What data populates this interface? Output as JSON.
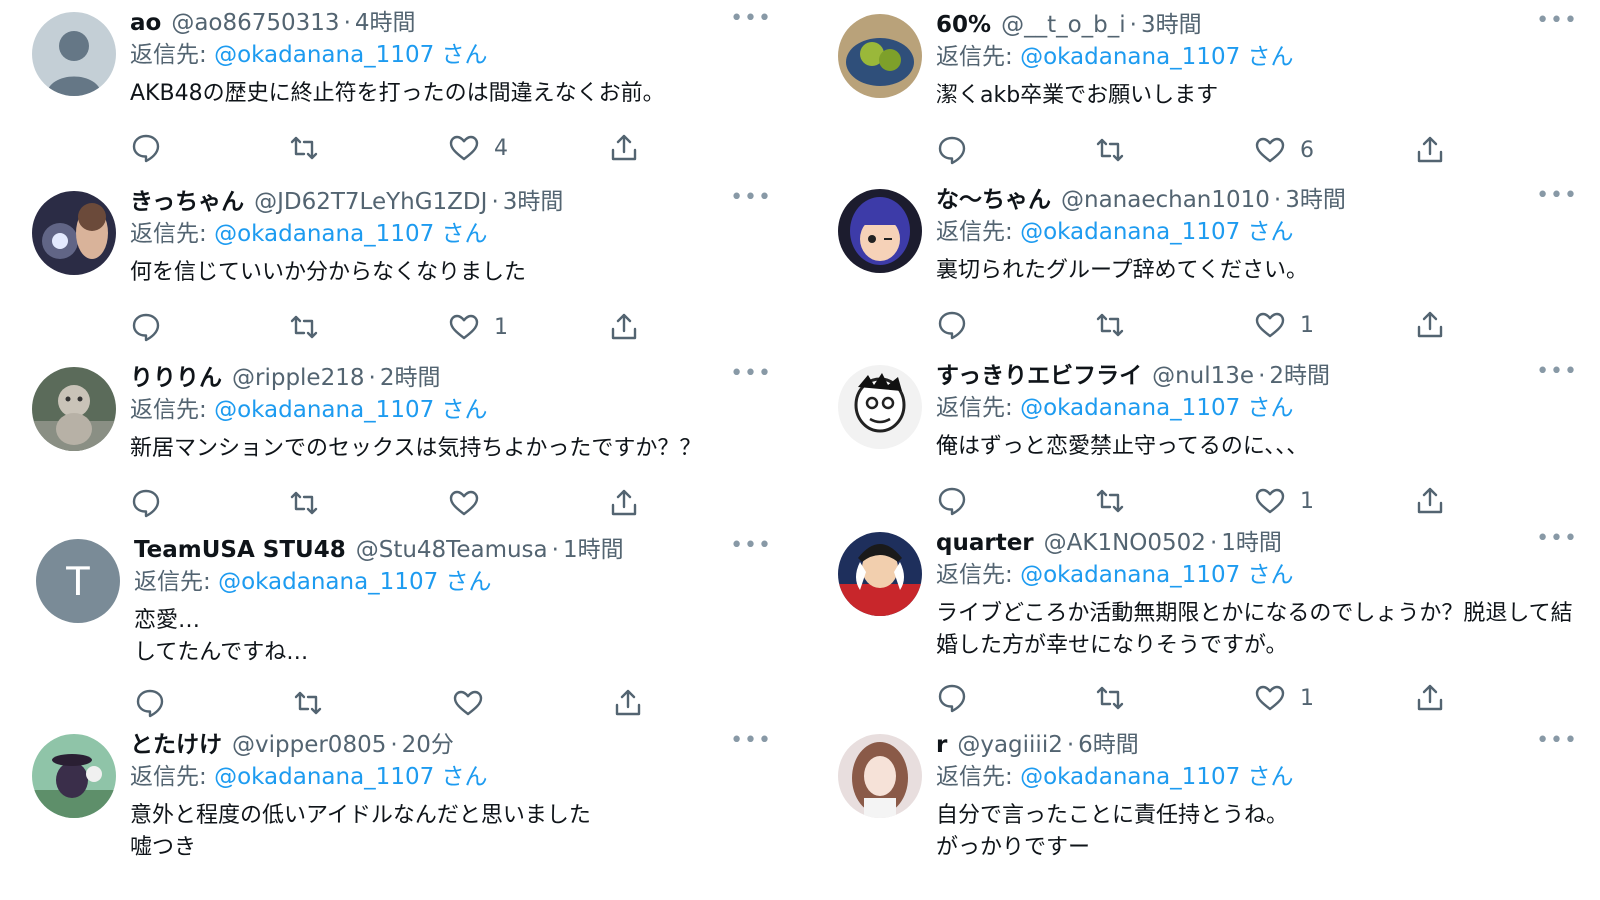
{
  "left": [
    {
      "name": "ao",
      "handle": "@ao86750313",
      "time": "4時間",
      "reply_prefix": "返信先:",
      "reply_to": "@okadanana_1107 さん",
      "text": "AKB48の歴史に終止符を打ったのは間違えなくお前。",
      "likes": "4",
      "avatar": "default-avatar-icon"
    },
    {
      "name": "きっちゃん",
      "handle": "@JD62T7LeYhG1ZDJ",
      "time": "3時間",
      "reply_prefix": "返信先:",
      "reply_to": "@okadanana_1107 さん",
      "text": "何を信じていいか分からなくなりました",
      "likes": "1",
      "avatar": "photo-avatar"
    },
    {
      "name": "りりりん",
      "handle": "@ripple218",
      "time": "2時間",
      "reply_prefix": "返信先:",
      "reply_to": "@okadanana_1107 さん",
      "text": "新居マンションでのセックスは気持ちよかったですか？？",
      "likes": "",
      "avatar": "photo-avatar"
    },
    {
      "name": "TeamUSA STU48",
      "handle": "@Stu48Teamusa",
      "time": "1時間",
      "reply_prefix": "返信先:",
      "reply_to": "@okadanana_1107 さん",
      "text": "恋愛…\nしてたんですね…",
      "likes": "",
      "avatar": "letter-avatar",
      "avatar_letter": "T"
    },
    {
      "name": "とたけけ",
      "handle": "@vipper0805",
      "time": "20分",
      "reply_prefix": "返信先:",
      "reply_to": "@okadanana_1107 さん",
      "text": "意外と程度の低いアイドルなんだと思いました\n嘘つき",
      "likes": "",
      "avatar": "photo-avatar"
    }
  ],
  "right": [
    {
      "name": "60%",
      "handle": "@__t_o_b_i",
      "time": "3時間",
      "reply_prefix": "返信先:",
      "reply_to": "@okadanana_1107 さん",
      "text": "潔くakb卒業でお願いします",
      "likes": "6",
      "avatar": "photo-avatar"
    },
    {
      "name": "な〜ちゃん",
      "handle": "@nanaechan1010",
      "time": "3時間",
      "reply_prefix": "返信先:",
      "reply_to": "@okadanana_1107 さん",
      "text": "裏切られたグループ辞めてください。",
      "likes": "1",
      "avatar": "photo-avatar"
    },
    {
      "name": "すっきりエビフライ",
      "handle": "@nul13e",
      "time": "2時間",
      "reply_prefix": "返信先:",
      "reply_to": "@okadanana_1107 さん",
      "text": "俺はずっと恋愛禁止守ってるのに、、、",
      "likes": "1",
      "avatar": "photo-avatar"
    },
    {
      "name": "quarter",
      "handle": "@AK1NO0502",
      "time": "1時間",
      "reply_prefix": "返信先:",
      "reply_to": "@okadanana_1107 さん",
      "text": "ライブどころか活動無期限とかになるのでしょうか？脱退して結婚した方が幸せになりそうですが。",
      "likes": "1",
      "avatar": "photo-avatar"
    },
    {
      "name": "r",
      "handle": "@yagiiii2",
      "time": "6時間",
      "reply_prefix": "返信先:",
      "reply_to": "@okadanana_1107 さん",
      "text": "自分で言ったことに責任持とうね。\nがっかりですー",
      "likes": "",
      "avatar": "photo-avatar"
    }
  ],
  "more_glyph": "•••",
  "dot_separator": "·",
  "colors": {
    "link": "#1d9bf0",
    "secondary": "#536471",
    "text": "#0f1419"
  }
}
